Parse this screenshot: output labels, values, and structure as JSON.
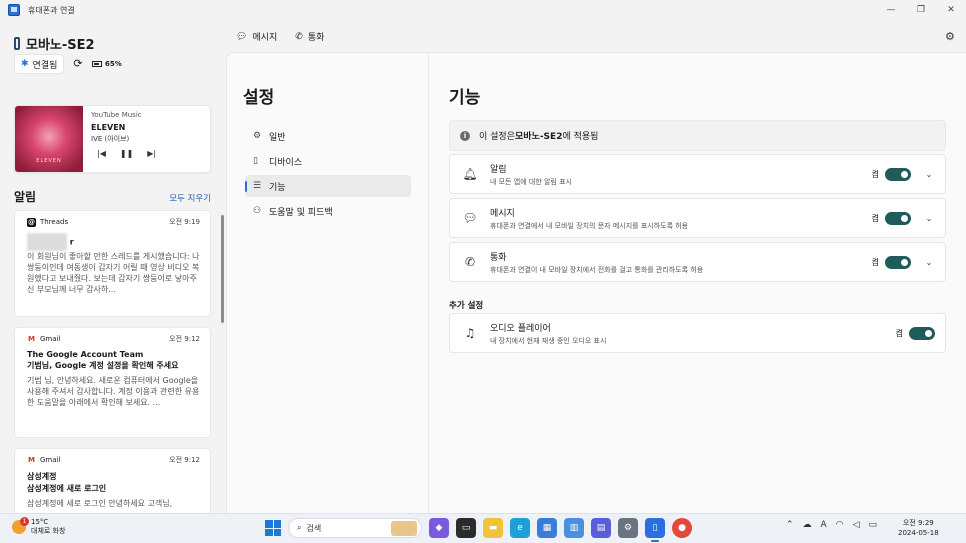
{
  "window": {
    "title": "휴대폰과 연결",
    "controls": [
      "—",
      "❐",
      "✕"
    ]
  },
  "device": {
    "name": "모바노-SE2",
    "connection": "연결됨",
    "battery": "65%"
  },
  "media": {
    "source": "YouTube Music",
    "title": "ELEVEN",
    "artist": "IVE (아이브)",
    "album_caption": "ELEVEN"
  },
  "notifications": {
    "title": "알림",
    "clear_all": "모두 지우기",
    "items": [
      {
        "app": "Threads",
        "time": "오전 9:19",
        "sender": "r",
        "body": "이 회원님이 좋아할 만한 스레드를 게시했습니다: 나 쌍둥이인데 여동생이 갑자기 어릴 때 영상 비디오 복원했다고 보내줬다. 보는데 갑자기 쌍둥이로 낳아주신 부모님께 너무 감사하..."
      },
      {
        "app": "Gmail",
        "time": "오전 9:12",
        "sender": "The Google Account Team",
        "subject": "기범님, Google 계정 설정을 확인해 주세요",
        "body": "기범 님, 안녕하세요. 새로운 컴퓨터에서 Google을 사용해 주셔서 감사합니다. 계정 이용과 관련한 유용한 도움말을 아래에서 확인해 보세요. ..."
      },
      {
        "app": "Gmail",
        "time": "오전 9:12",
        "sender": "삼성계정",
        "subject": "삼성계정에 새로 로그인",
        "body": "삼성계정에 새로 로그인 안녕하세요 고객님,"
      }
    ]
  },
  "tabs": {
    "messages": "메시지",
    "calls": "통화"
  },
  "settings_nav": {
    "title": "설정",
    "items": [
      {
        "label": "일반",
        "icon": "gear-icon"
      },
      {
        "label": "디바이스",
        "icon": "phone-icon"
      },
      {
        "label": "기능",
        "icon": "list-icon"
      },
      {
        "label": "도움말 및 피드백",
        "icon": "help-icon"
      }
    ],
    "active": "기능"
  },
  "features": {
    "title": "기능",
    "info_prefix": "이 설정은 ",
    "info_device": "모바노-SE2",
    "info_suffix": "에 적용됨",
    "items": [
      {
        "title": "알림",
        "desc": "내 모든 앱에 대한 알림 표시",
        "state": "켬",
        "icon": "bell-icon"
      },
      {
        "title": "메시지",
        "desc": "휴대폰과 연결에서 내 모바일 장치의 문자 메시지를 표시하도록 허용",
        "state": "켬",
        "icon": "message-icon"
      },
      {
        "title": "통화",
        "desc": "휴대폰과 연결이 내 모바일 장치에서 전화를 걸고 통화를 관리하도록 허용",
        "state": "켬",
        "icon": "call-icon"
      }
    ],
    "additional_title": "추가 설정",
    "additional": [
      {
        "title": "오디오 플레이어",
        "desc": "내 장치에서 현재 재생 중인 오디오 표시",
        "state": "켬",
        "icon": "music-icon"
      }
    ]
  },
  "taskbar": {
    "weather_temp": "15°C",
    "weather_desc": "대체로 화창",
    "weather_badge": "1",
    "search_placeholder": "검색",
    "time": "오전 9:29",
    "date": "2024-05-18",
    "tray_lang": "A"
  },
  "colors": {
    "accent": "#2a6fdb",
    "toggle_on": "#1f5b5b",
    "link": "#2a5fb0"
  }
}
